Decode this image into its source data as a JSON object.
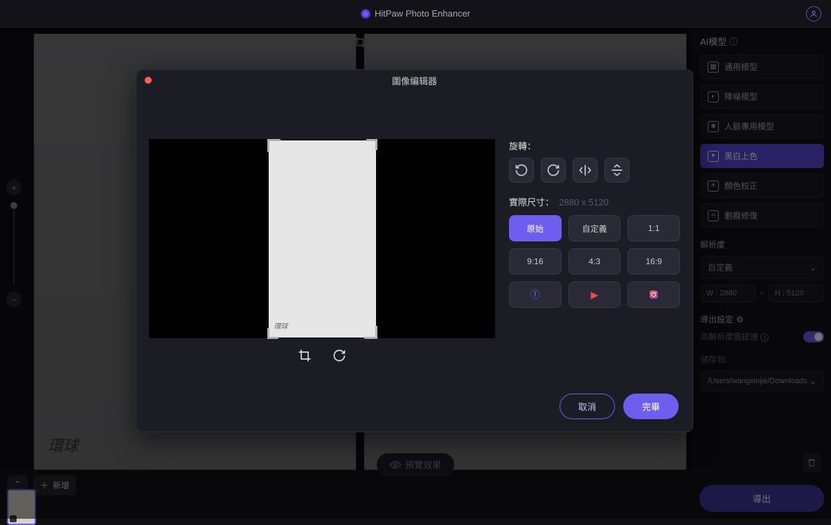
{
  "app": {
    "title": "HitPaw Photo Enhancer"
  },
  "sidebar": {
    "title": "AI模型",
    "models": [
      {
        "label": "通用模型"
      },
      {
        "label": "降噪模型"
      },
      {
        "label": "人臉專用模型"
      },
      {
        "label": "黑白上色"
      },
      {
        "label": "顏色校正"
      },
      {
        "label": "劃痕修復"
      }
    ],
    "resolution_label": "解析度",
    "resolution_select": "自定義",
    "width_placeholder": "W : 2880",
    "height_placeholder": "H : 5120",
    "export_settings_label": "導出設定",
    "hires_speed_label": "高解析度圖提速",
    "save_to_label": "儲存到:",
    "save_path": "/Users/wangxinjie/Downloads"
  },
  "bottom": {
    "add_label": "新增",
    "preview_label": "預覽效果"
  },
  "export": {
    "label": "導出"
  },
  "modal": {
    "title": "圖像编辑器",
    "rotate_label": "旋轉：",
    "rotate_btns": {
      "ccw": "90°",
      "cw": "90°"
    },
    "size_label": "實際尺寸：",
    "size_value": "2880 x 5120",
    "ratios": [
      "原始",
      "自定義",
      "1:1",
      "9:16",
      "4:3",
      "16:9"
    ],
    "cancel": "取消",
    "done": "完畢"
  },
  "watermark": "環球"
}
